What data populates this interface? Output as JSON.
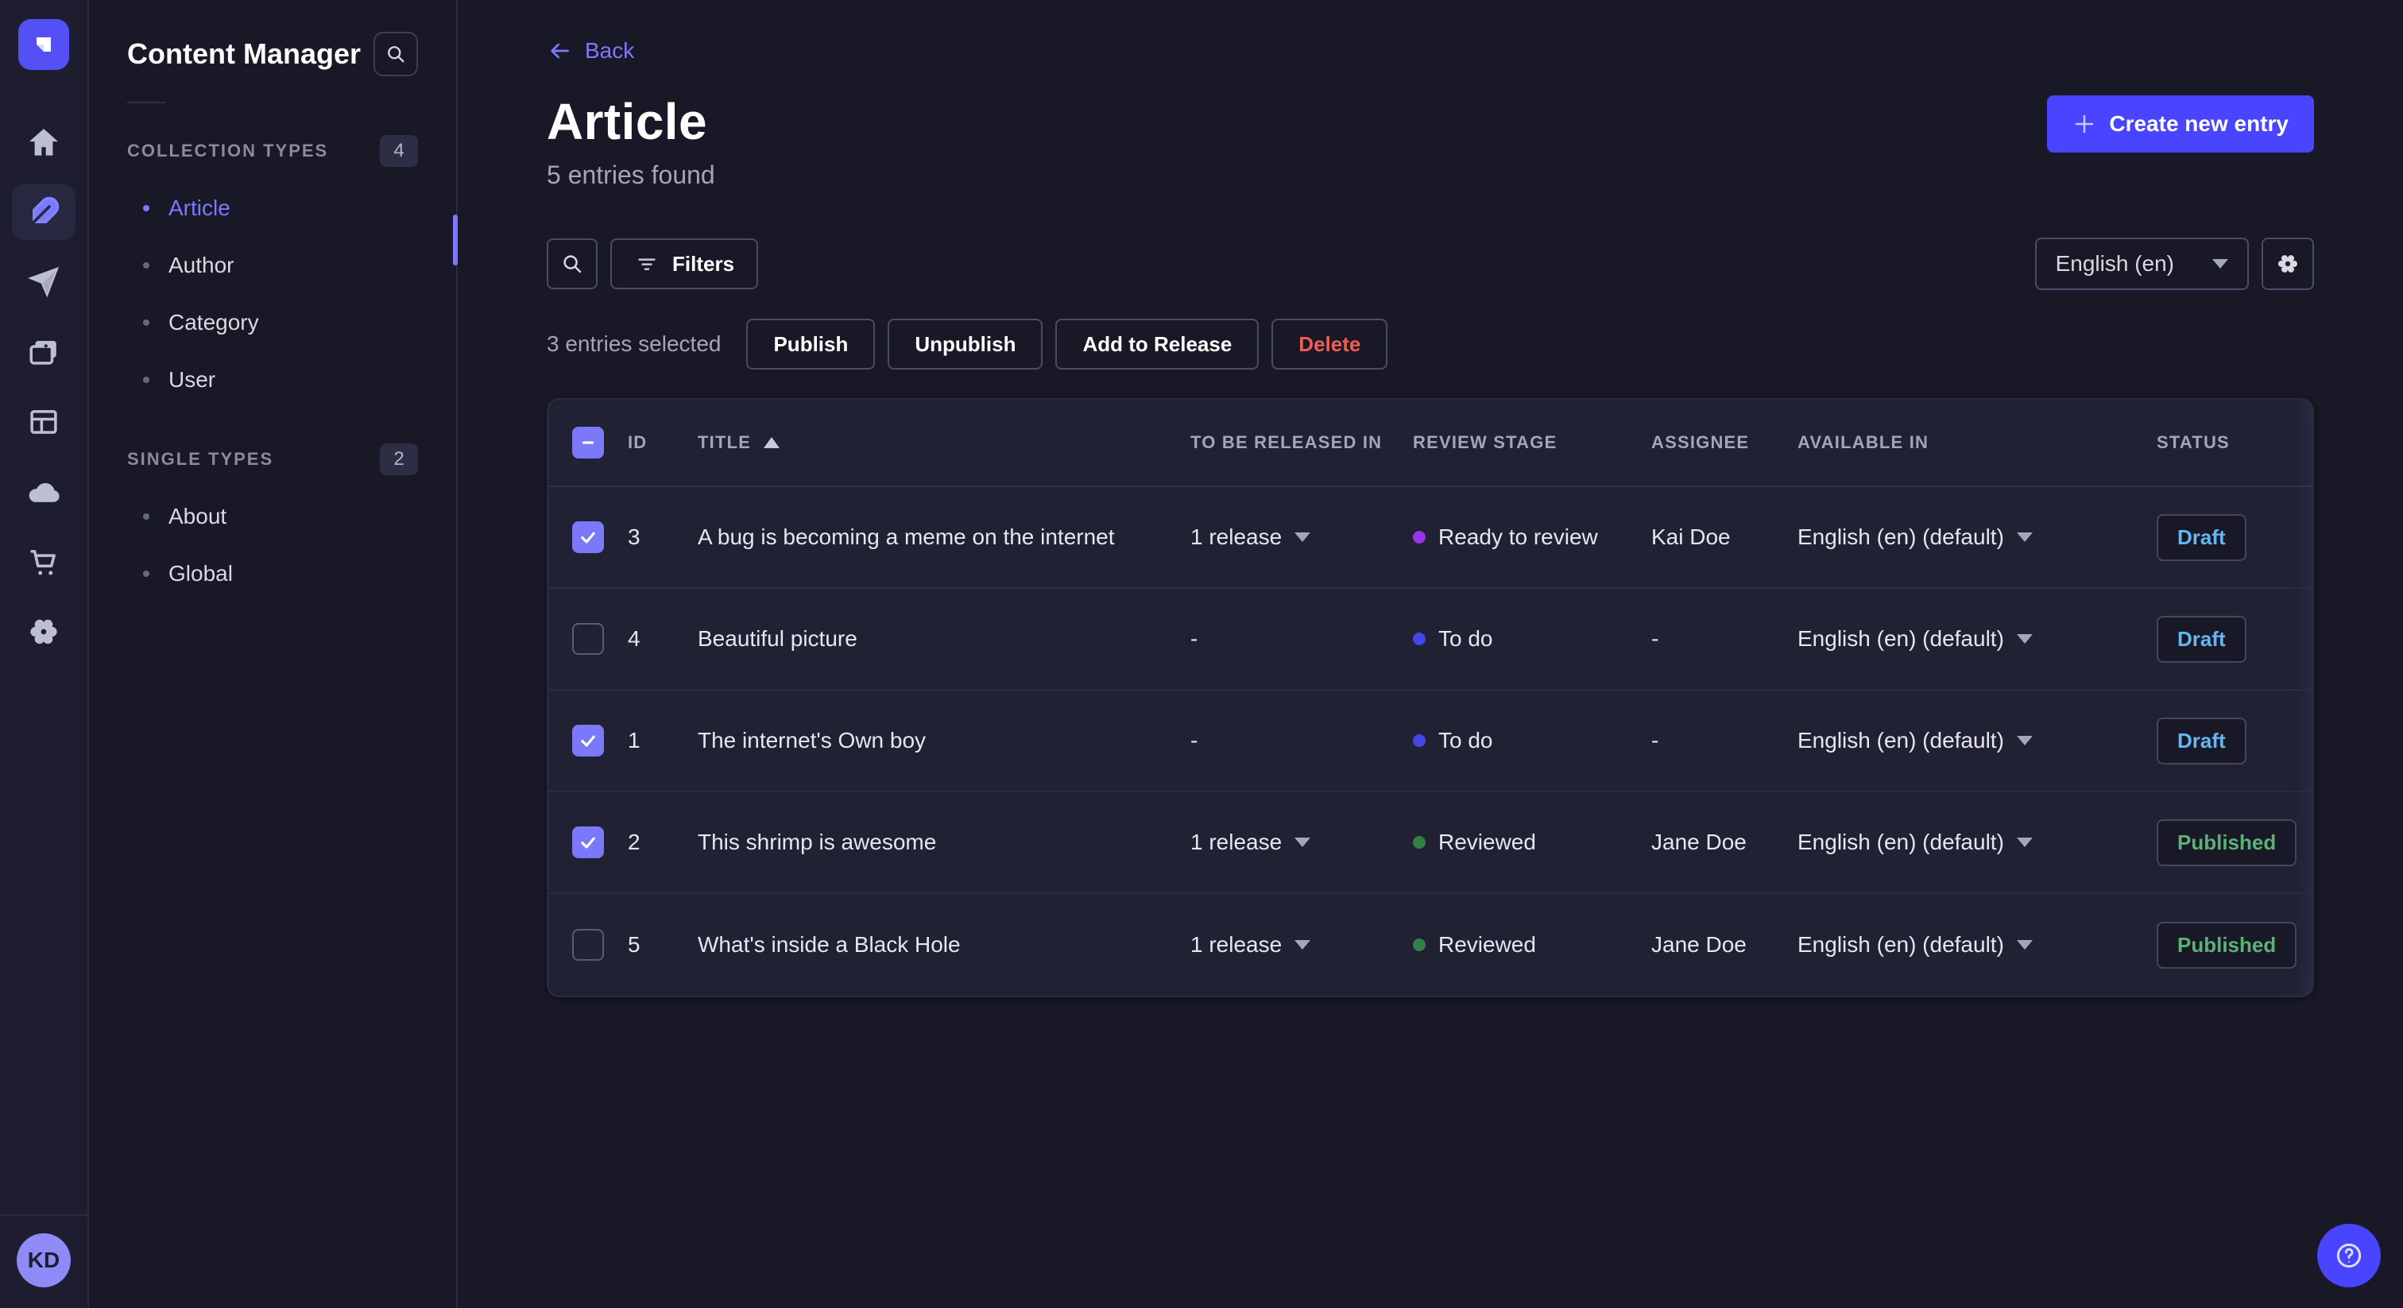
{
  "palette": {
    "accent": "#4945ff",
    "link": "#7b79ff",
    "checkbox": "#7b79fa",
    "danger": "#ee5e52",
    "draft": "#66b7f1",
    "published": "#5cb176",
    "todo": "#4346e6",
    "ready": "#9736e6",
    "reviewed": "#328048",
    "avatar_bg": "#8e8af7"
  },
  "iconbar": {
    "icons": [
      "strapi-logo",
      "home",
      "content-manager-feather",
      "release-plane",
      "media-library",
      "content-type-builder",
      "deploy-cloud",
      "marketplace-cart",
      "settings-gear"
    ],
    "active": "content-manager-feather"
  },
  "user": {
    "initials": "KD"
  },
  "nav": {
    "title": "Content Manager",
    "sections": [
      {
        "label": "COLLECTION TYPES",
        "badge": "4",
        "items": [
          {
            "label": "Article",
            "active": true
          },
          {
            "label": "Author",
            "active": false
          },
          {
            "label": "Category",
            "active": false
          },
          {
            "label": "User",
            "active": false
          }
        ]
      },
      {
        "label": "SINGLE TYPES",
        "badge": "2",
        "items": [
          {
            "label": "About",
            "active": false
          },
          {
            "label": "Global",
            "active": false
          }
        ]
      }
    ]
  },
  "header": {
    "back_label": "Back",
    "title": "Article",
    "subtitle": "5 entries found",
    "create_label": "Create new entry"
  },
  "toolbar": {
    "filters_label": "Filters",
    "locale": "English (en)"
  },
  "bulk": {
    "selected_text": "3 entries selected",
    "actions": [
      "Publish",
      "Unpublish",
      "Add to Release",
      "Delete"
    ]
  },
  "table": {
    "select_all_state": "indeterminate",
    "columns": [
      "ID",
      "TITLE",
      "TO BE RELEASED IN",
      "REVIEW STAGE",
      "ASSIGNEE",
      "AVAILABLE IN",
      "STATUS"
    ],
    "sort": {
      "column": "TITLE",
      "direction": "asc"
    },
    "rows": [
      {
        "checked": true,
        "id": "3",
        "title": "A bug is becoming a meme on the internet",
        "release": "1 release",
        "stage": "Ready to review",
        "stage_variant": "ready",
        "assignee": "Kai Doe",
        "locale": "English (en) (default)",
        "status": "Draft",
        "status_variant": "draft"
      },
      {
        "checked": false,
        "id": "4",
        "title": "Beautiful picture",
        "release": "-",
        "stage": "To do",
        "stage_variant": "todo",
        "assignee": "-",
        "locale": "English (en) (default)",
        "status": "Draft",
        "status_variant": "draft"
      },
      {
        "checked": true,
        "id": "1",
        "title": "The internet's Own boy",
        "release": "-",
        "stage": "To do",
        "stage_variant": "todo",
        "assignee": "-",
        "locale": "English (en) (default)",
        "status": "Draft",
        "status_variant": "draft"
      },
      {
        "checked": true,
        "id": "2",
        "title": "This shrimp is awesome",
        "release": "1 release",
        "stage": "Reviewed",
        "stage_variant": "reviewed",
        "assignee": "Jane Doe",
        "locale": "English (en) (default)",
        "status": "Published",
        "status_variant": "published"
      },
      {
        "checked": false,
        "id": "5",
        "title": "What's inside a Black Hole",
        "release": "1 release",
        "stage": "Reviewed",
        "stage_variant": "reviewed",
        "assignee": "Jane Doe",
        "locale": "English (en) (default)",
        "status": "Published",
        "status_variant": "published"
      }
    ]
  },
  "help": {
    "tooltip": "?"
  }
}
